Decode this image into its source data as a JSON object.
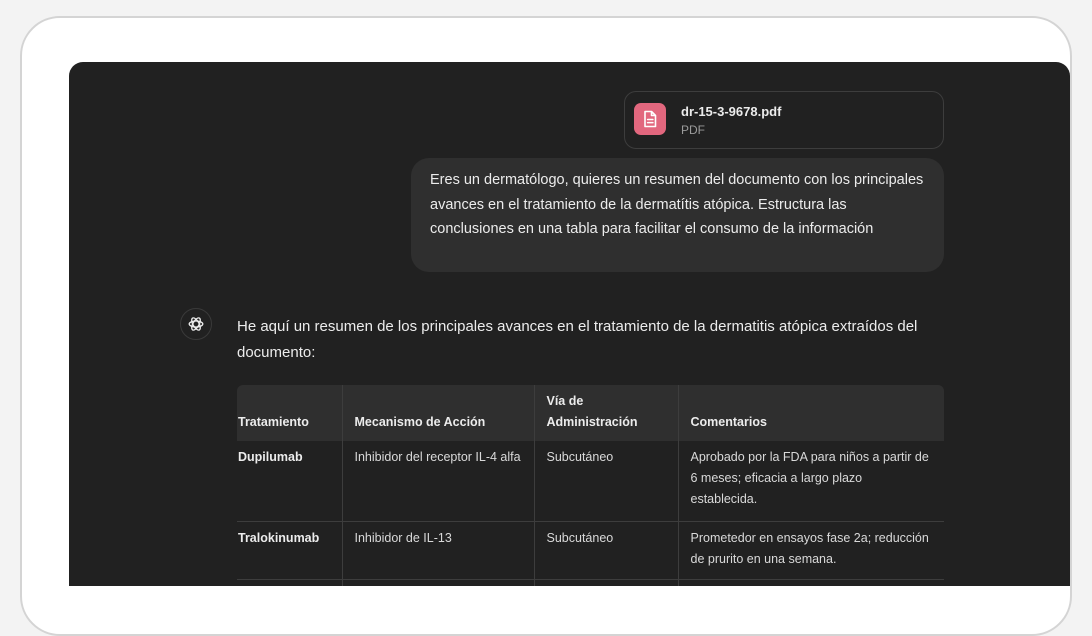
{
  "attachment": {
    "file_name": "dr-15-3-9678.pdf",
    "file_type": "PDF",
    "icon": "document-icon",
    "icon_color": "#e2677e"
  },
  "user_message": {
    "text": "Eres un dermatólogo, quieres un resumen del documento con los principales avances en el tratamiento de la dermatítis atópica. Estructura las conclusiones en una tabla para facilitar el consumo de la información"
  },
  "assistant": {
    "avatar_icon": "openai-logo-icon",
    "intro": "He aquí un resumen de los principales avances en el tratamiento de la dermatitis atópica extraídos del documento:",
    "table": {
      "headers": [
        "Tratamiento",
        "Mecanismo de Acción",
        "Vía de Administración",
        "Comentarios"
      ],
      "rows": [
        [
          "Dupilumab",
          "Inhibidor del receptor IL-4 alfa",
          "Subcutáneo",
          "Aprobado por la FDA para niños a partir de 6 meses; eficacia a largo plazo establecida."
        ],
        [
          "Tralokinumab",
          "Inhibidor de IL-13",
          "Subcutáneo",
          "Prometedor en ensayos fase 2a; reducción de prurito en una semana."
        ]
      ]
    }
  },
  "colors": {
    "background": "#212121",
    "bubble": "#2f2f2f",
    "text": "#ececec"
  }
}
